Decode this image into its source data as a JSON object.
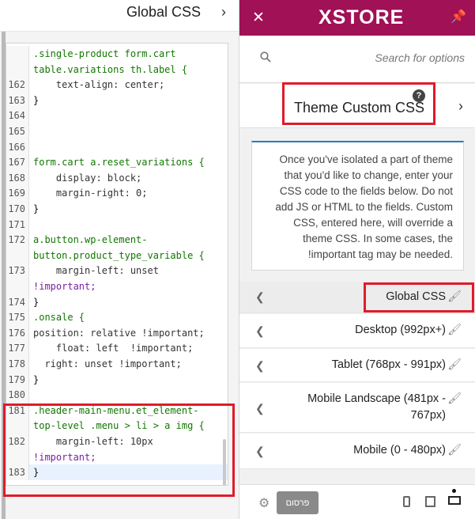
{
  "left_panel": {
    "title": "Global CSS",
    "chevron": "›",
    "code_lines": [
      {
        "no": "",
        "text": ".single-product form.cart",
        "kind": "selector"
      },
      {
        "no": "",
        "text": "table.variations th.label {",
        "kind": "selector"
      },
      {
        "no": "162",
        "text": "    text-align: center;",
        "kind": "decl"
      },
      {
        "no": "163",
        "text": "}",
        "kind": "plain"
      },
      {
        "no": "164",
        "text": "",
        "kind": "plain"
      },
      {
        "no": "165",
        "text": "",
        "kind": "plain"
      },
      {
        "no": "166",
        "text": "",
        "kind": "plain"
      },
      {
        "no": "167",
        "text": "form.cart a.reset_variations {",
        "kind": "selector"
      },
      {
        "no": "168",
        "text": "    display: block;",
        "kind": "decl"
      },
      {
        "no": "169",
        "text": "    margin-right: 0;",
        "kind": "decl"
      },
      {
        "no": "170",
        "text": "}",
        "kind": "plain"
      },
      {
        "no": "171",
        "text": "",
        "kind": "plain"
      },
      {
        "no": "172",
        "text": "a.button.wp-element-",
        "kind": "selector"
      },
      {
        "no": "",
        "text": "button.product_type_variable {",
        "kind": "selector"
      },
      {
        "no": "173",
        "text": "    margin-left: unset",
        "kind": "decl"
      },
      {
        "no": "",
        "text": "!important;",
        "kind": "kw"
      },
      {
        "no": "174",
        "text": "}",
        "kind": "plain"
      },
      {
        "no": "175",
        "text": ".onsale {",
        "kind": "selector"
      },
      {
        "no": "176",
        "text": "position: relative !important;",
        "kind": "decl"
      },
      {
        "no": "177",
        "text": "    float: left  !important;",
        "kind": "decl"
      },
      {
        "no": "178",
        "text": "  right: unset !important;",
        "kind": "decl"
      },
      {
        "no": "179",
        "text": "}",
        "kind": "plain"
      },
      {
        "no": "180",
        "text": "",
        "kind": "plain"
      },
      {
        "no": "181",
        "text": ".header-main-menu.et_element-",
        "kind": "selector"
      },
      {
        "no": "",
        "text": "top-level .menu > li > a img {",
        "kind": "selector"
      },
      {
        "no": "182",
        "text": "    margin-left: 10px",
        "kind": "decl"
      },
      {
        "no": "",
        "text": "!important;",
        "kind": "kw"
      },
      {
        "no": "183",
        "text": "}",
        "kind": "plain"
      }
    ]
  },
  "sidebar": {
    "close_icon": "close-icon",
    "logo": "XSTORE",
    "pin_icon": "pin-icon",
    "brand_color": "#a01156",
    "search": {
      "placeholder": "Search for options"
    },
    "section": {
      "title": "Theme Custom CSS",
      "help": "?",
      "chevron": "›"
    },
    "description": "Once you've isolated a part of theme that you'd like to change, enter your CSS code to the fields below. Do not add JS or HTML to the fields. Custom CSS, entered here, will override a theme CSS. In some cases, the !important tag may be needed.",
    "items": [
      {
        "label": "Global CSS",
        "active": true
      },
      {
        "label": "Desktop (992px+)",
        "active": false
      },
      {
        "label": "Tablet (768px - 991px)",
        "active": false
      },
      {
        "label": "Mobile Landscape (481px - 767px)",
        "active": false
      },
      {
        "label": "Mobile (0 - 480px)",
        "active": false
      }
    ],
    "footer": {
      "publish_label": "פרסום"
    }
  }
}
